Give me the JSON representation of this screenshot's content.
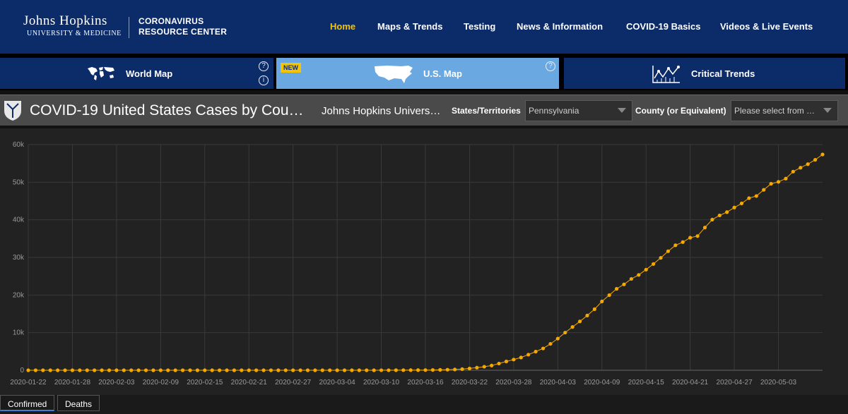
{
  "header": {
    "logo_main": "Johns Hopkins",
    "logo_sub": "UNIVERSITY & MEDICINE",
    "site_line1": "CORONAVIRUS",
    "site_line2": "RESOURCE CENTER",
    "nav": [
      "Home",
      "Maps & Trends",
      "Testing",
      "News & Information",
      "COVID-19 Basics",
      "Videos & Live Events"
    ],
    "active_nav": "Home"
  },
  "tabs": {
    "world": "World Map",
    "us": "U.S. Map",
    "trends": "Critical Trends",
    "new_badge": "NEW",
    "help_glyph": "?",
    "info_glyph": "i"
  },
  "dashboard": {
    "title": "COVID-19 United States Cases by Cou…",
    "subtitle": "Johns Hopkins Univers…",
    "state_label": "States/Territories",
    "state_value": "Pennsylvania",
    "county_label": "County (or Equivalent)",
    "county_placeholder": "Please select from …"
  },
  "bottom_tabs": [
    "Confirmed",
    "Deaths"
  ],
  "colors": {
    "header_bg": "#0c2b69",
    "accent_yellow": "#f5c400",
    "selected_tab": "#6aa8e2",
    "series_color": "#f5a800"
  },
  "chart_data": {
    "type": "line",
    "title": "",
    "xlabel": "",
    "ylabel": "",
    "ylim": [
      0,
      60000
    ],
    "yticks": [
      "0",
      "10k",
      "20k",
      "30k",
      "40k",
      "50k",
      "60k"
    ],
    "x_tick_labels": [
      "2020-01-22",
      "2020-01-28",
      "2020-02-03",
      "2020-02-09",
      "2020-02-15",
      "2020-02-21",
      "2020-02-27",
      "2020-03-04",
      "2020-03-10",
      "2020-03-16",
      "2020-03-22",
      "2020-03-28",
      "2020-04-03",
      "2020-04-09",
      "2020-04-15",
      "2020-04-21",
      "2020-04-27",
      "2020-05-03"
    ],
    "x_start": "2020-01-22",
    "x_end": "2020-05-08",
    "grid": true,
    "series": [
      {
        "values": [
          0,
          0,
          0,
          0,
          0,
          0,
          0,
          0,
          0,
          0,
          0,
          0,
          0,
          0,
          0,
          0,
          0,
          0,
          0,
          0,
          0,
          0,
          0,
          0,
          0,
          0,
          0,
          0,
          0,
          0,
          0,
          0,
          0,
          0,
          0,
          0,
          0,
          0,
          0,
          0,
          0,
          0,
          0,
          0,
          0,
          0,
          0,
          0,
          12,
          16,
          22,
          33,
          41,
          47,
          63,
          76,
          112,
          152,
          206,
          303,
          479,
          698,
          946,
          1260,
          1795,
          2345,
          2845,
          3394,
          4155,
          4963,
          5805,
          7016,
          8420,
          10017,
          11510,
          12980,
          14559,
          16239,
          18300,
          19979,
          21655,
          22833,
          24295,
          25345,
          26753,
          28258,
          29888,
          31652,
          33232,
          34077,
          35249,
          35684,
          37950,
          40049,
          41165,
          42050,
          43264,
          44366,
          45763,
          46327,
          47971,
          49579,
          50092,
          50957,
          52816,
          53864,
          54800,
          55956,
          57371
        ]
      }
    ]
  }
}
